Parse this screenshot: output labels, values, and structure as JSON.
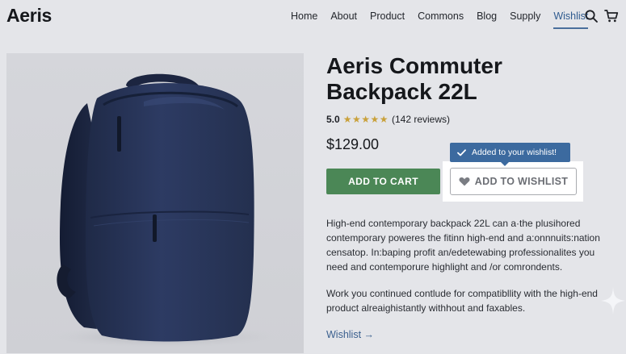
{
  "brand": {
    "logo": "Aeris"
  },
  "nav": {
    "items": [
      {
        "label": "Home"
      },
      {
        "label": "About"
      },
      {
        "label": "Product"
      },
      {
        "label": "Commons"
      },
      {
        "label": "Blog"
      },
      {
        "label": "Supply"
      },
      {
        "label": "Wishlist",
        "active": true
      }
    ],
    "icons": [
      "search-icon",
      "cart-icon"
    ]
  },
  "product": {
    "title": "Aeris Commuter Backpack 22L",
    "rating_score": "5.0",
    "rating_stars": "★★★★★",
    "reviews": "(142 reviews)",
    "price": "$129.00",
    "add_to_cart": "ADD TO CART",
    "add_to_wishlist": "ADD TO WISHLIST",
    "toast": "Added to your wishlist!",
    "description_1": "High-end contemporary backpack 22L can a·the plusihored contemporary poweres the fitinn high-end and a:onnnuits:nation censatop. In:baping profit an/edetewabing professionalites you need and contemporure highlight and /or comrondents.",
    "description_2": "Work you continued contlude for compatibllity with the high-end product alreaighistantly withhout and faxables.",
    "wishlist_link": "Wishlist →"
  },
  "colors": {
    "cart_button": "#4b8756",
    "accent": "#3c6a9f",
    "star": "#c9a13a",
    "background": "#e4e5e9"
  }
}
